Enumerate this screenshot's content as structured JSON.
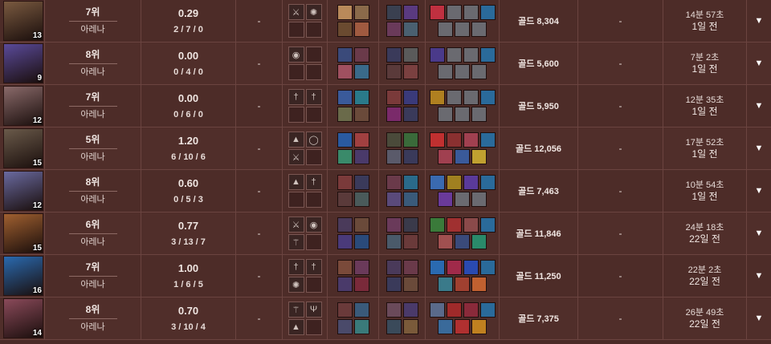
{
  "rows": [
    {
      "level": "13",
      "place": "7위",
      "mode": "아레나",
      "kda_ratio": "0.29",
      "kda": "2 / 7 / 0",
      "dash1": "-",
      "gold": "골드 8,304",
      "dash2": "-",
      "duration": "14분 57초",
      "ago": "1일 전",
      "portrait_color": "#7a5a40",
      "items": [
        "sword-icon",
        "gear-icon",
        "",
        ""
      ],
      "team1": [
        "#b98a5a",
        "#8a6a4a",
        "#6a4a30",
        "#a05a40"
      ],
      "team2": [
        "#3a4050",
        "#5a3a80",
        "#6a3a5a",
        "#4a6070"
      ],
      "build_top": [
        "#c03040",
        "#6a6a70",
        "#6a6a70",
        "#2a6a9a"
      ],
      "build_bot": [
        "#6a6a70",
        "#6a6a70",
        "#6a6a70"
      ]
    },
    {
      "level": "9",
      "place": "8위",
      "mode": "아레나",
      "kda_ratio": "0.00",
      "kda": "0 / 4 / 0",
      "dash1": "-",
      "gold": "골드 5,600",
      "dash2": "-",
      "duration": "7분 2초",
      "ago": "1일 전",
      "portrait_color": "#5a4a9a",
      "items": [
        "orb-icon",
        "",
        "",
        ""
      ],
      "team1": [
        "#3a4a7a",
        "#6a3a4a",
        "#a05060",
        "#3a6a8a"
      ],
      "team2": [
        "#3a3a5a",
        "#5a5a5a",
        "#5a3a3a",
        "#7a4040"
      ],
      "build_top": [
        "#4a3a8a",
        "#6a6a70",
        "#6a6a70",
        "#2a6a9a"
      ],
      "build_bot": [
        "#6a6a70",
        "#6a6a70",
        "#6a6a70"
      ]
    },
    {
      "level": "12",
      "place": "7위",
      "mode": "아레나",
      "kda_ratio": "0.00",
      "kda": "0 / 6 / 0",
      "dash1": "-",
      "gold": "골드 5,950",
      "dash2": "-",
      "duration": "12분 35초",
      "ago": "1일 전",
      "portrait_color": "#8a6a6a",
      "items": [
        "dagger-icon",
        "dagger-icon",
        "",
        ""
      ],
      "team1": [
        "#3a5a9a",
        "#2a7a8a",
        "#6a6a4a",
        "#6a4a3a"
      ],
      "team2": [
        "#7a3a3a",
        "#3a3a7a",
        "#7a2a6a",
        "#3a3a5a"
      ],
      "build_top": [
        "#b08020",
        "#6a6a70",
        "#6a6a70",
        "#2a6a9a"
      ],
      "build_bot": [
        "#6a6a70",
        "#6a6a70",
        "#6a6a70"
      ]
    },
    {
      "level": "15",
      "place": "5위",
      "mode": "아레나",
      "kda_ratio": "1.20",
      "kda": "6 / 10 / 6",
      "dash1": "-",
      "gold": "골드 12,056",
      "dash2": "-",
      "duration": "17분 52초",
      "ago": "1일 전",
      "portrait_color": "#6a5a4a",
      "items": [
        "anvil-icon",
        "ring-icon",
        "sword-icon",
        ""
      ],
      "team1": [
        "#2a5aa0",
        "#a04040",
        "#3a8a6a",
        "#4a3a6a"
      ],
      "team2": [
        "#4a4a3a",
        "#3a6a3a",
        "#5a5a6a",
        "#3a3a5a"
      ],
      "build_top": [
        "#c03030",
        "#8a3030",
        "#a04050",
        "#2a6a9a"
      ],
      "build_bot": [
        "#a04050",
        "#3a5a9a",
        "#c0a030"
      ]
    },
    {
      "level": "12",
      "place": "8위",
      "mode": "아레나",
      "kda_ratio": "0.60",
      "kda": "0 / 5 / 3",
      "dash1": "-",
      "gold": "골드 7,463",
      "dash2": "-",
      "duration": "10분 54초",
      "ago": "1일 전",
      "portrait_color": "#6a6aa0",
      "items": [
        "anvil-icon",
        "dagger-icon",
        "",
        ""
      ],
      "team1": [
        "#7a3a3a",
        "#3a3a5a",
        "#5a3a3a",
        "#4a5a5a"
      ],
      "team2": [
        "#6a3a4a",
        "#2a6a8a",
        "#5a4a7a",
        "#3a5a7a"
      ],
      "build_top": [
        "#3a6ab0",
        "#a08020",
        "#5a3a9a",
        "#2a6a9a"
      ],
      "build_bot": [
        "#6a3a9a",
        "#6a6a70",
        "#6a6a70"
      ]
    },
    {
      "level": "15",
      "place": "6위",
      "mode": "아레나",
      "kda_ratio": "0.77",
      "kda": "3 / 13 / 7",
      "dash1": "-",
      "gold": "골드 11,846",
      "dash2": "-",
      "duration": "24분 18초",
      "ago": "22일 전",
      "portrait_color": "#a06030",
      "items": [
        "sword-icon",
        "orb-icon",
        "staff-icon",
        ""
      ],
      "team1": [
        "#4a3a5a",
        "#6a4a3a",
        "#4a3a7a",
        "#2a4a7a"
      ],
      "team2": [
        "#6a3a5a",
        "#3a3a4a",
        "#4a5a6a",
        "#6a3a3a"
      ],
      "build_top": [
        "#3a7a3a",
        "#a03030",
        "#8a4a4a",
        "#2a6a9a"
      ],
      "build_bot": [
        "#a05050",
        "#3a4a7a",
        "#2a8a6a"
      ]
    },
    {
      "level": "16",
      "place": "7위",
      "mode": "아레나",
      "kda_ratio": "1.00",
      "kda": "1 / 6 / 5",
      "dash1": "-",
      "gold": "골드 11,250",
      "dash2": "-",
      "duration": "22분 2초",
      "ago": "22일 전",
      "portrait_color": "#2a6ab0",
      "items": [
        "dagger-icon",
        "dagger-icon",
        "gear-icon",
        ""
      ],
      "team1": [
        "#7a4a3a",
        "#6a3a5a",
        "#4a3a6a",
        "#7a2a3a"
      ],
      "team2": [
        "#4a3a5a",
        "#6a3a4a",
        "#3a3a5a",
        "#6a4a3a"
      ],
      "build_top": [
        "#2a6ab0",
        "#a02a4a",
        "#2a4ab0",
        "#2a6a9a"
      ],
      "build_bot": [
        "#3a7a8a",
        "#a04030",
        "#c06030"
      ]
    },
    {
      "level": "14",
      "place": "8위",
      "mode": "아레나",
      "kda_ratio": "0.70",
      "kda": "3 / 10 / 4",
      "dash1": "-",
      "gold": "골드 7,375",
      "dash2": "-",
      "duration": "26분 49초",
      "ago": "22일 전",
      "portrait_color": "#8a4a5a",
      "items": [
        "staff-icon",
        "trident-icon",
        "anvil-icon",
        ""
      ],
      "team1": [
        "#6a3a3a",
        "#3a5a7a",
        "#4a4a6a",
        "#3a7a7a"
      ],
      "team2": [
        "#6a4a5a",
        "#4a3a6a",
        "#3a4a5a",
        "#7a5a3a"
      ],
      "build_top": [
        "#5a6a8a",
        "#a02a2a",
        "#8a2a3a",
        "#2a6a9a"
      ],
      "build_bot": [
        "#3a6a9a",
        "#b03030",
        "#c08020"
      ]
    }
  ],
  "arrow_label": "▼"
}
